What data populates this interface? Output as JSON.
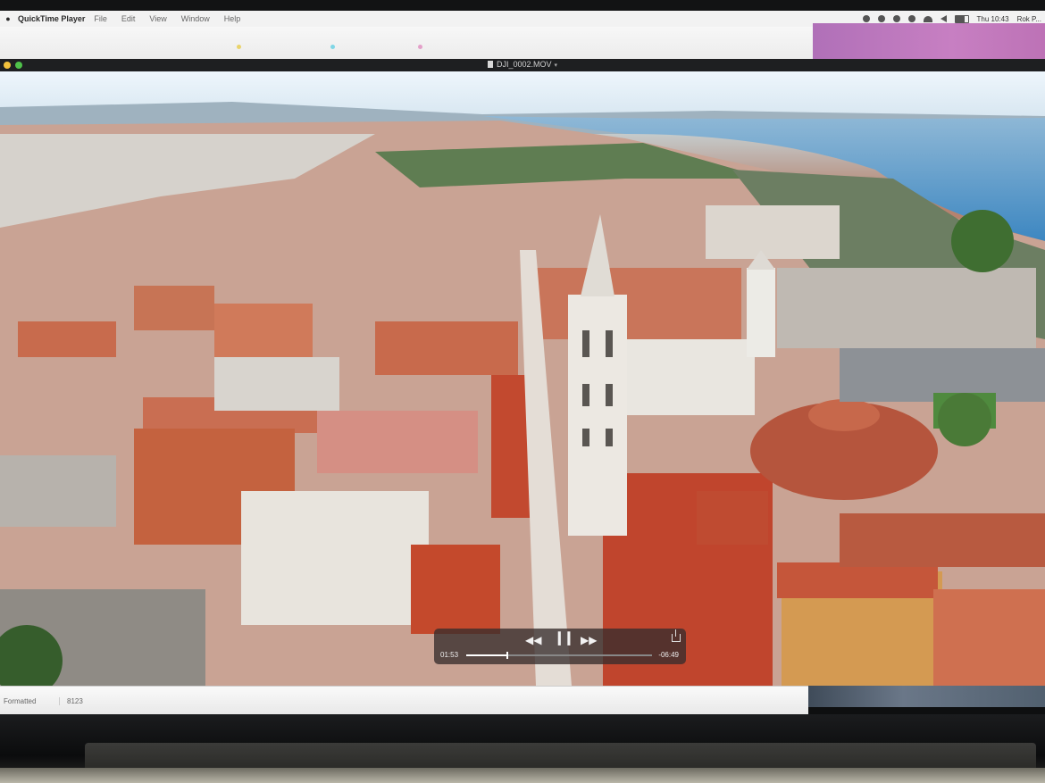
{
  "menubar": {
    "apple": "",
    "app_name": "QuickTime Player",
    "items": [
      "File",
      "Edit",
      "View",
      "Window",
      "Help"
    ],
    "clock": "Thu 10:43",
    "user": "Rok P..."
  },
  "window": {
    "title": "DJI_0002.MOV"
  },
  "player": {
    "elapsed": "01:53",
    "remaining": "-06:49",
    "progress_fraction": 0.22
  },
  "bottom_bar": {
    "left_label": "Formatted",
    "mid_label": "8123"
  },
  "colors": {
    "menubar_bg": "#f2f2f2",
    "titlebar_bg": "#1e1f21",
    "close_button": "#f4c23c",
    "minimize_button": "#4fc14a",
    "hud_bg": "rgba(55,45,45,0.78)"
  },
  "icons": {
    "rewind": "rewind-icon",
    "play_pause": "pause-icon",
    "fast_forward": "fast-forward-icon",
    "share": "share-icon"
  }
}
